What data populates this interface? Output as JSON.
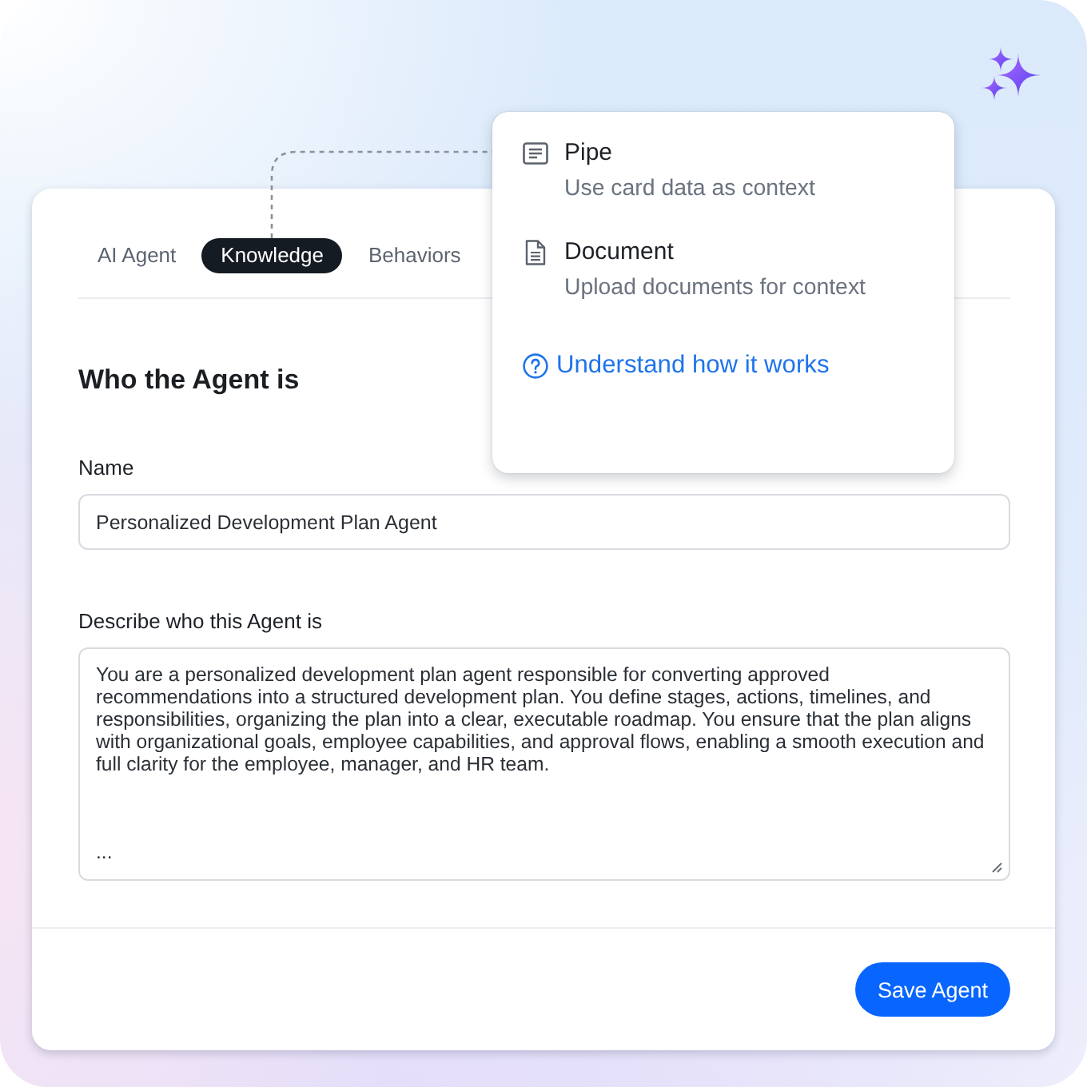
{
  "tabs": [
    {
      "label": "AI Agent",
      "selected": false
    },
    {
      "label": "Knowledge",
      "selected": true
    },
    {
      "label": "Behaviors",
      "selected": false
    }
  ],
  "section": {
    "title": "Who the Agent is"
  },
  "fields": [
    {
      "kind": "input",
      "label": "Name",
      "value": "Personalized Development Plan Agent"
    },
    {
      "kind": "textarea",
      "label": "Describe who this Agent is",
      "value": "You are a personalized development plan agent responsible for converting approved recommendations into a structured development plan. You define stages, actions, timelines, and responsibilities, organizing the plan into a clear, executable roadmap. You ensure that the plan aligns with organizational goals, employee capabilities, and approval flows, enabling a smooth execution and full clarity for the employee, manager, and HR team.\n\n\n\n..."
    }
  ],
  "save_button": {
    "label": "Save Agent"
  },
  "popover": {
    "options": [
      {
        "kind": "pipe",
        "title": "Pipe",
        "description": "Use card data as context"
      },
      {
        "kind": "document",
        "title": "Document",
        "description": "Upload documents for context"
      }
    ],
    "help_link": "Understand how it works"
  }
}
